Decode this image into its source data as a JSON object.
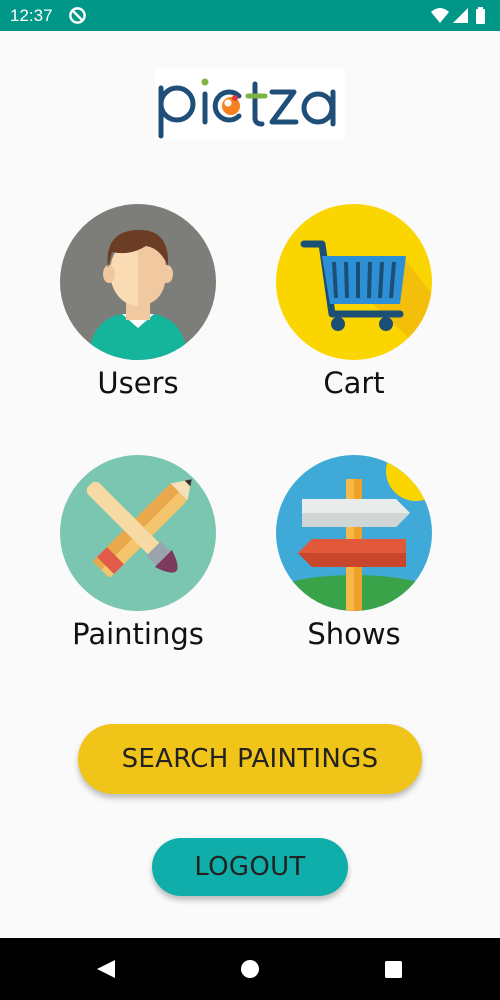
{
  "status_bar": {
    "time": "12:37",
    "icons": [
      "sync-disabled-icon",
      "wifi-icon",
      "cellular-signal-icon",
      "battery-icon"
    ],
    "background": "#009688"
  },
  "app": {
    "logo_text": "pictza",
    "logo_colors": {
      "text": "#1f4e79",
      "dot_orange": "#f5821f",
      "dot_red": "#e53935",
      "accent_green": "#7cb342"
    }
  },
  "menu": {
    "users_label": "Users",
    "cart_label": "Cart",
    "paintings_label": "Paintings",
    "shows_label": "Shows"
  },
  "buttons": {
    "search_label": "SEARCH PAINTINGS",
    "search_color": "#f0c419",
    "logout_label": "LOGOUT",
    "logout_color": "#10aeaa"
  },
  "nav_bar": {
    "icons": [
      "back-icon",
      "home-icon",
      "recents-icon"
    ]
  }
}
